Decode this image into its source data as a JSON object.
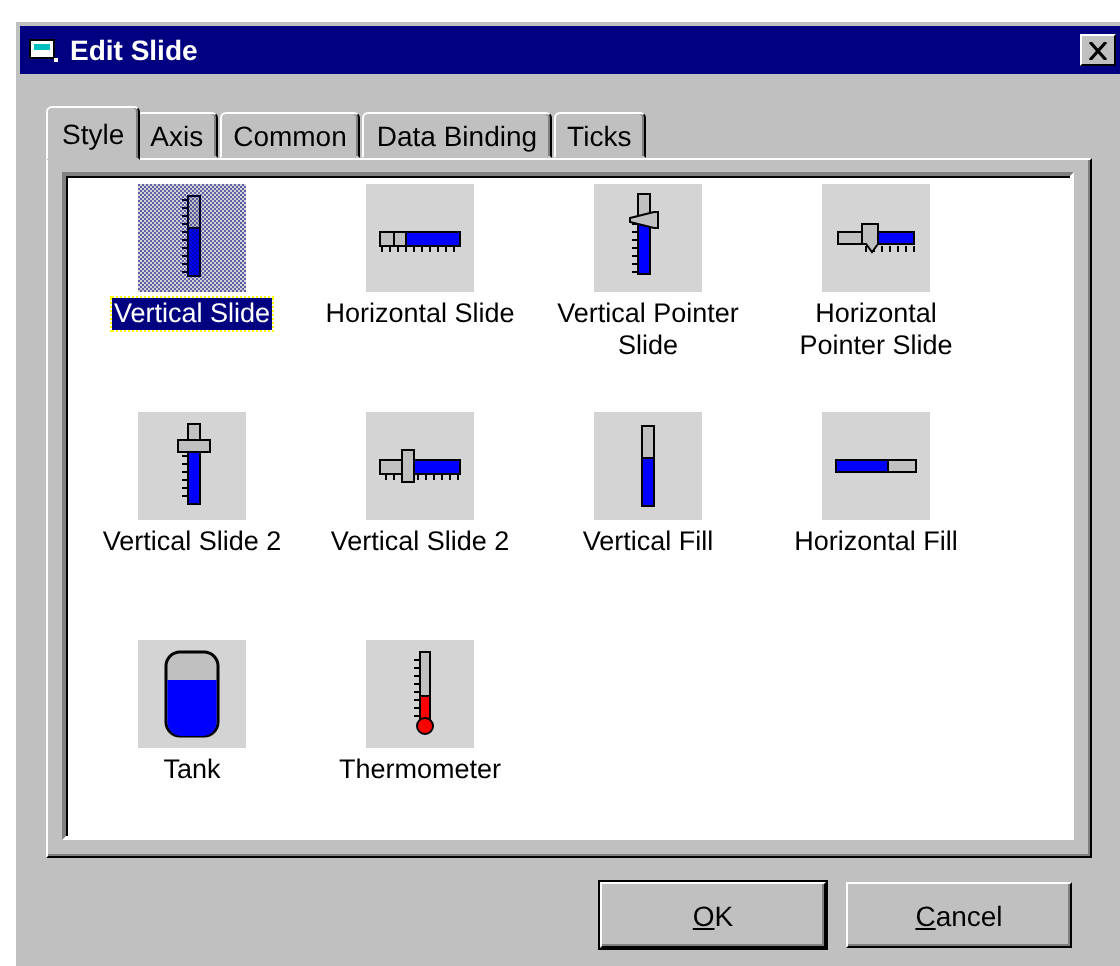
{
  "window": {
    "title": "Edit Slide"
  },
  "tabs": [
    {
      "label": "Style",
      "selected": true
    },
    {
      "label": "Axis",
      "selected": false
    },
    {
      "label": "Common",
      "selected": false
    },
    {
      "label": "Data Binding",
      "selected": false
    },
    {
      "label": "Ticks",
      "selected": false
    }
  ],
  "styles": [
    {
      "label": "Vertical Slide",
      "kind": "vslide",
      "selected": true
    },
    {
      "label": "Horizontal Slide",
      "kind": "hslide",
      "selected": false
    },
    {
      "label": "Vertical Pointer Slide",
      "kind": "vpointer",
      "selected": false
    },
    {
      "label": "Horizontal Pointer Slide",
      "kind": "hpointer",
      "selected": false
    },
    {
      "label": "Vertical Slide 2",
      "kind": "vslide2",
      "selected": false
    },
    {
      "label": "Vertical Slide 2",
      "kind": "hslide2",
      "selected": false
    },
    {
      "label": "Vertical Fill",
      "kind": "vfill",
      "selected": false
    },
    {
      "label": "Horizontal Fill",
      "kind": "hfill",
      "selected": false
    },
    {
      "label": "Tank",
      "kind": "tank",
      "selected": false
    },
    {
      "label": "Thermometer",
      "kind": "thermometer",
      "selected": false
    }
  ],
  "buttons": [
    {
      "label": "OK",
      "kind": "default"
    },
    {
      "label": "Cancel",
      "kind": "normal"
    }
  ]
}
